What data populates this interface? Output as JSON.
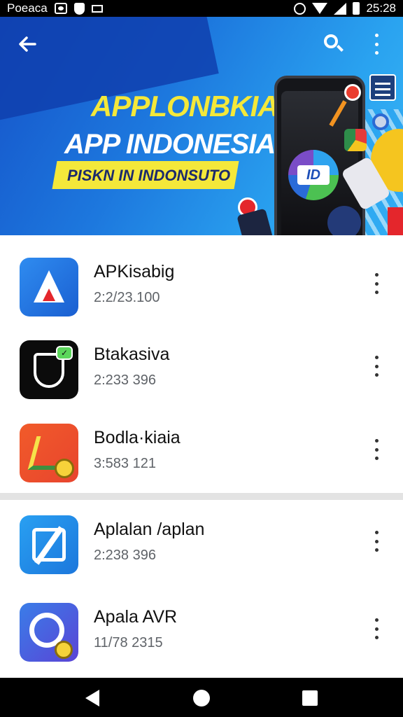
{
  "status_bar": {
    "carrier": "Poeaca",
    "time": "25:28",
    "left_icons": [
      "notification-box-icon",
      "shield-icon",
      "image-icon"
    ],
    "right_icons": [
      "alarm-icon",
      "wifi-icon",
      "signal-icon",
      "battery-icon"
    ]
  },
  "banner": {
    "title_line1": "APPLONBKIAI",
    "title_line2": "APP INDONESIA",
    "subtitle": "PISKN IN INDONSUTO",
    "logo_text": "ID",
    "colors": {
      "background": "#1d78de",
      "title_yellow": "#f4e83a",
      "pill_yellow": "#f4e83a"
    }
  },
  "toolbar": {
    "back_icon": "arrow-left-icon",
    "search_icon": "search-icon",
    "menu_icon": "more-vert-icon"
  },
  "apps": [
    {
      "name": "APKisabig",
      "meta": "2:2/23.100",
      "icon": "app-a-icon"
    },
    {
      "name": "Btakasiva",
      "meta": "2:233 396",
      "icon": "app-shield-icon"
    },
    {
      "name": "Bodla·kiaia",
      "meta": "3:583 121",
      "icon": "app-chart-coin-icon"
    },
    {
      "name": "Aplalan /aplan",
      "meta": "2:238 396",
      "icon": "app-edit-icon"
    },
    {
      "name": "Apala AVR",
      "meta": "11/78 2315",
      "icon": "app-ring-icon"
    }
  ],
  "nav_bar": {
    "back": "back-triangle-icon",
    "home": "home-circle-icon",
    "recent": "recent-square-icon"
  }
}
